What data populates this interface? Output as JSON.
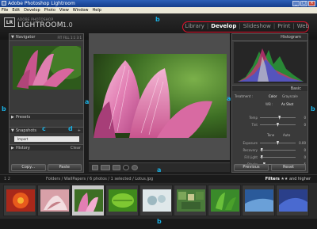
{
  "window": {
    "title": "Adobe Photoshop Lightroom"
  },
  "menu": [
    "File",
    "Edit",
    "Develop",
    "Photo",
    "View",
    "Window",
    "Help"
  ],
  "brand": {
    "logo": "LR",
    "top": "ADOBE PHOTOSHOP",
    "name": "LIGHTROOM",
    "version": "1.0"
  },
  "modules": {
    "items": [
      "Library",
      "Develop",
      "Slideshow",
      "Print",
      "Web"
    ],
    "active": "Develop"
  },
  "annotations": {
    "a": "a",
    "b": "b",
    "c": "c",
    "d": "d"
  },
  "left_panel": {
    "navigator": "Navigator",
    "zoom": "FIT  FILL  1:1  3:1",
    "presets": "Presets",
    "snapshots": "Snapshots",
    "snapshot_item": "Import",
    "history": "History",
    "history_action": "Clear",
    "copy": "Copy...",
    "paste": "Paste"
  },
  "right_panel": {
    "histogram": "Histogram",
    "basic": "Basic",
    "treatment": "Treatment :",
    "color": "Color",
    "grayscale": "Grayscale",
    "wb_label": "WB :",
    "wb_value": "As Shot",
    "tone": "Tone",
    "auto": "Auto",
    "sliders": [
      {
        "label": "Temp",
        "value": "0",
        "pos": 0.55
      },
      {
        "label": "Tint",
        "value": "0",
        "pos": 0.5
      },
      {
        "label": "Exposure",
        "value": "0.00",
        "pos": 0.5
      },
      {
        "label": "Recovery",
        "value": "0",
        "pos": 0.05
      },
      {
        "label": "Fill Light",
        "value": "0",
        "pos": 0.05
      },
      {
        "label": "Blacks",
        "value": "5",
        "pos": 0.12
      }
    ],
    "previous": "Previous",
    "reset": "Reset"
  },
  "filmstrip": {
    "numbers": "1  2",
    "path": "Folders / WallPapers / 6 photos / 1 selected / Lotus.jpg",
    "filters": "Filters",
    "filter_value": "and higher"
  }
}
